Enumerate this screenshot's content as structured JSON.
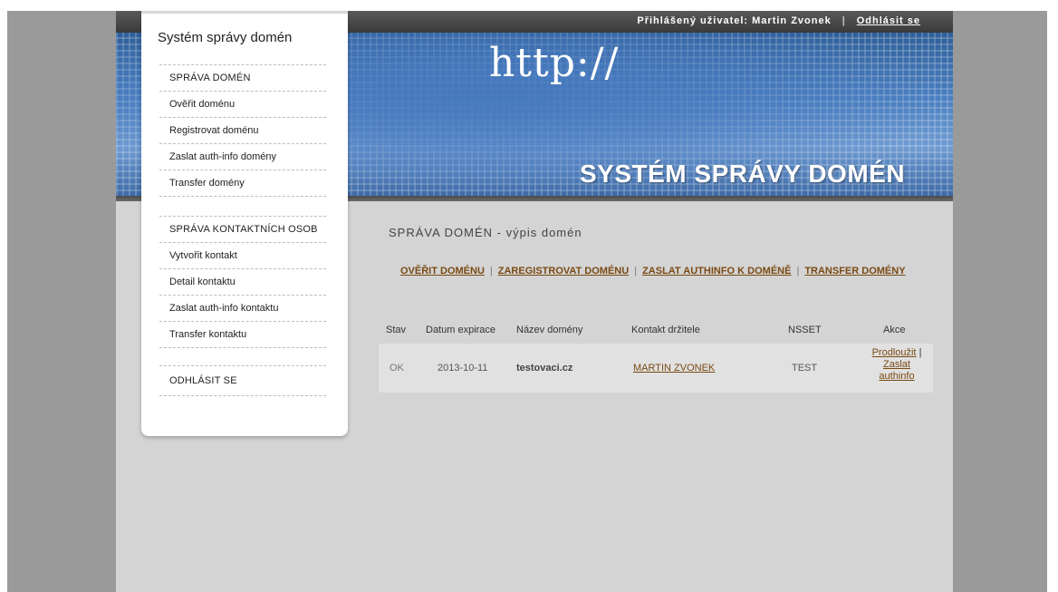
{
  "header": {
    "logged_user_label": "Přihlášený uživatel:",
    "user_name": "Martin Zvonek",
    "separator": "|",
    "logout_link": "Odhlásit se"
  },
  "banner": {
    "http_text": "http://",
    "title": "SYSTÉM SPRÁVY DOMÉN"
  },
  "sidebar": {
    "title": "Systém správy domén",
    "groups": [
      {
        "items": [
          "SPRÁVA DOMÉN",
          "Ověřit doménu",
          "Registrovat doménu",
          "Zaslat auth-info domény",
          "Transfer domény"
        ]
      },
      {
        "items": [
          "SPRÁVA KONTAKTNÍCH OSOB",
          "Vytvořit kontakt",
          "Detail kontaktu",
          "Zaslat auth-info kontaktu",
          "Transfer kontaktu"
        ]
      },
      {
        "items": [
          "ODHLÁSIT SE"
        ]
      }
    ]
  },
  "main": {
    "title": "SPRÁVA DOMÉN - výpis domén",
    "actions": [
      "OVĚŘIT DOMÉNU",
      "ZAREGISTROVAT DOMÉNU",
      "ZASLAT AUTHINFO K DOMÉNĚ",
      "TRANSFER DOMÉNY"
    ],
    "action_separator": "|",
    "table": {
      "columns": [
        "Stav",
        "Datum expirace",
        "Název domény",
        "Kontakt držitele",
        "NSSET",
        "Akce"
      ],
      "rows": [
        {
          "stav": "OK",
          "datum": "2013-10-11",
          "nazev": "testovaci.cz",
          "kontakt": "MARTIN ZVONEK",
          "nsset": "TEST",
          "akce_prodlouzit": "Prodloužit",
          "akce_sep": "|",
          "akce_zaslat_1": "Zaslat",
          "akce_zaslat_2": "authinfo"
        }
      ]
    }
  },
  "colors": {
    "link": "#7a4a12",
    "page_bg": "#d4d4d4",
    "outer_bg": "#9a9a9a",
    "banner_blue": "#4a7fc0"
  }
}
